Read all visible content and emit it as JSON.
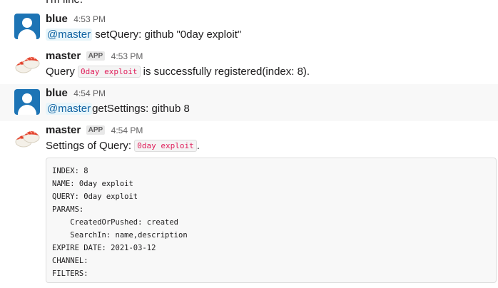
{
  "partial_line": "I'm fine.",
  "messages": [
    {
      "author": "blue",
      "time": "4:53 PM",
      "mention": "@master",
      "text": "setQuery: github \"0day exploit\""
    },
    {
      "author": "master",
      "badge": "APP",
      "time": "4:53 PM",
      "text_before": "Query ",
      "code": "0day exploit",
      "text_after": " is successfully registered(index: 8)."
    },
    {
      "author": "blue",
      "time": "4:54 PM",
      "mention": "@master",
      "text": "getSettings: github 8"
    },
    {
      "author": "master",
      "badge": "APP",
      "time": "4:54 PM",
      "text_before": "Settings of Query: ",
      "code": "0day exploit",
      "text_after": ".",
      "code_block": "INDEX: 8\nNAME: 0day exploit\nQUERY: 0day exploit\nPARAMS:\n    CreatedOrPushed: created\n    SearchIn: name,description\nEXPIRE DATE: 2021-03-12\nCHANNEL:\nFILTERS:"
    }
  ]
}
